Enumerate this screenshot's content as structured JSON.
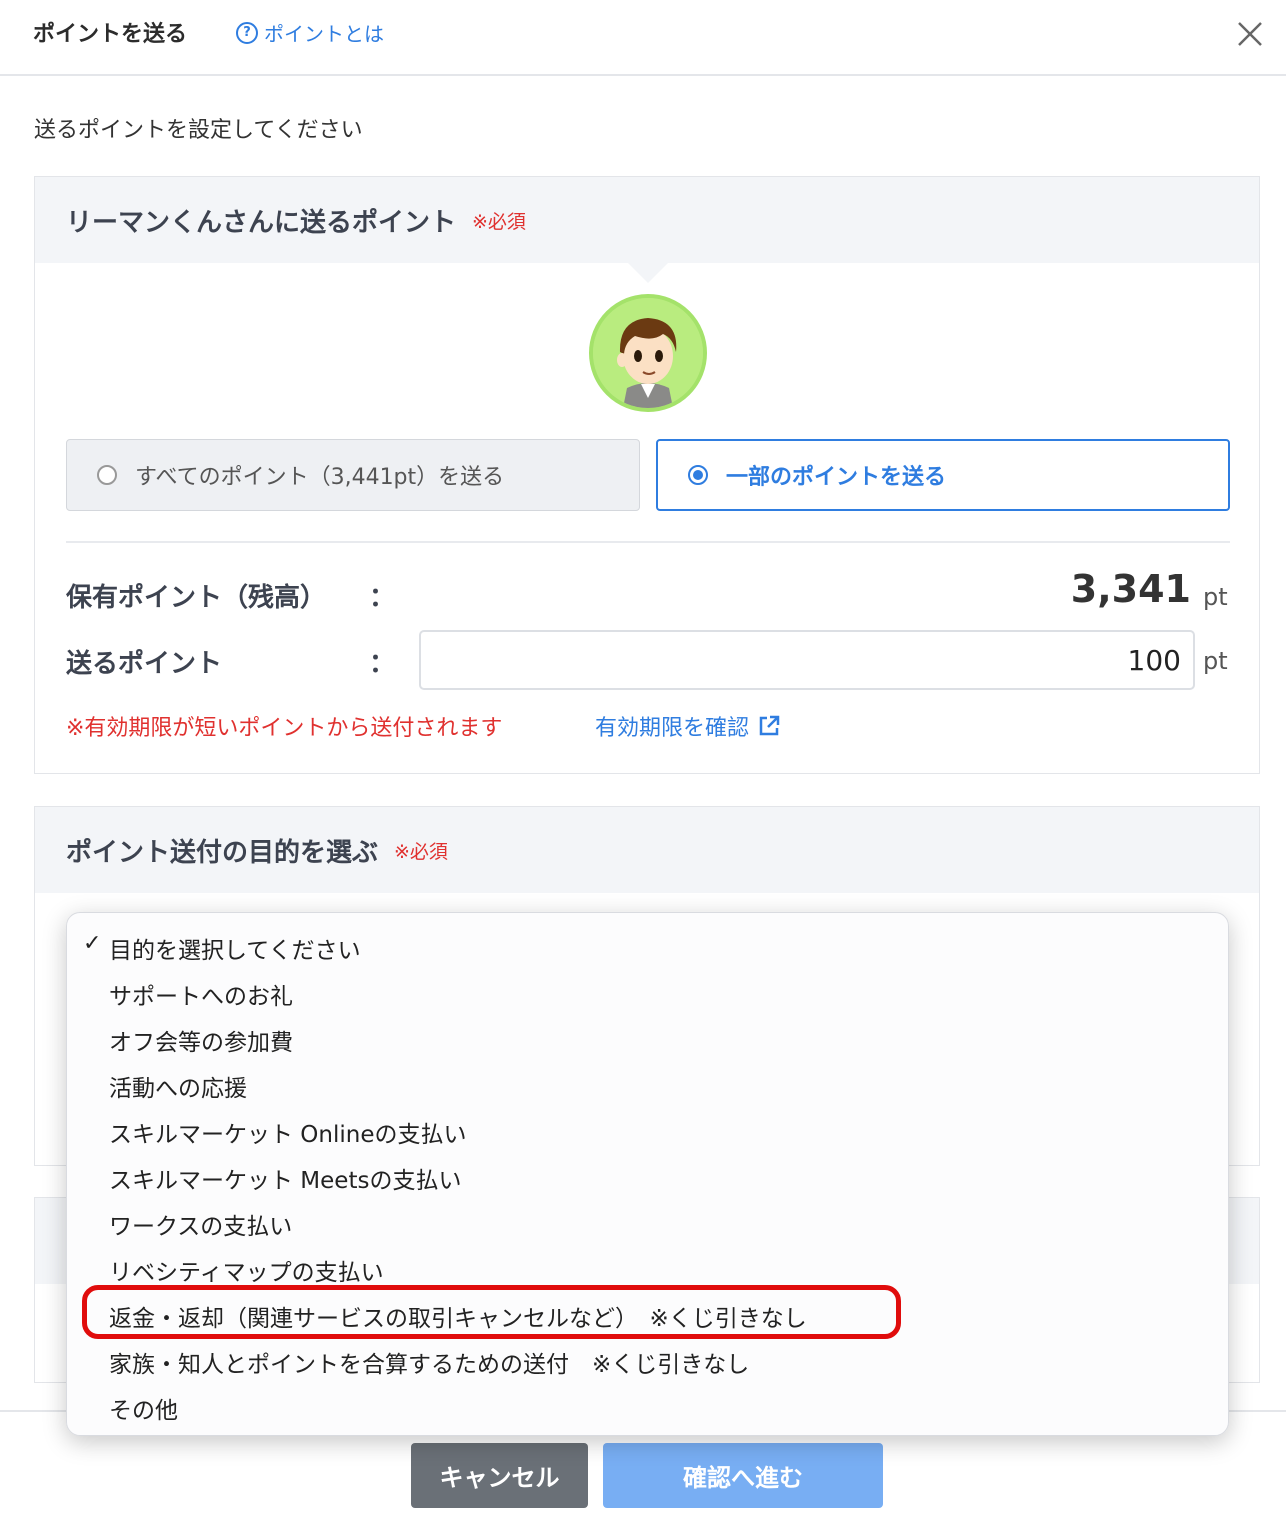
{
  "header": {
    "title": "ポイントを送る",
    "help_icon": "?",
    "help_link": "ポイントとは"
  },
  "subtitle": "送るポイントを設定してください",
  "send_card": {
    "title": "リーマンくんさんに送るポイント",
    "required": "※必須",
    "option_all": "すべてのポイント（3,441pt）を送る",
    "option_partial": "一部のポイントを送る",
    "selected_option": "partial",
    "balance_label": "保有ポイント（残高）",
    "balance_value": "3,341",
    "send_label": "送るポイント",
    "colon": "：",
    "send_value": "100",
    "unit": "pt",
    "warning": "※有効期限が短いポイントから送付されます",
    "expiry_link": "有効期限を確認"
  },
  "purpose_card": {
    "title": "ポイント送付の目的を選ぶ",
    "required": "※必須"
  },
  "dropdown": {
    "check_mark": "✓",
    "options": [
      "目的を選択してください",
      "サポートへのお礼",
      "オフ会等の参加費",
      "活動への応援",
      "スキルマーケット Onlineの支払い",
      "スキルマーケット Meetsの支払い",
      "ワークスの支払い",
      "リベシティマップの支払い",
      "返金・返却（関連サービスの取引キャンセルなど）　※くじ引きなし",
      "家族・知人とポイントを合算するための送付　※くじ引きなし",
      "その他"
    ],
    "selected_index": 0,
    "highlighted_index": 8
  },
  "footer": {
    "cancel": "キャンセル",
    "confirm": "確認へ進む"
  },
  "colors": {
    "accent": "#2f7de0",
    "required": "#e0312f",
    "highlight": "#e00c0c",
    "cancel_bg": "#6a7077",
    "confirm_bg": "#78aef3"
  }
}
